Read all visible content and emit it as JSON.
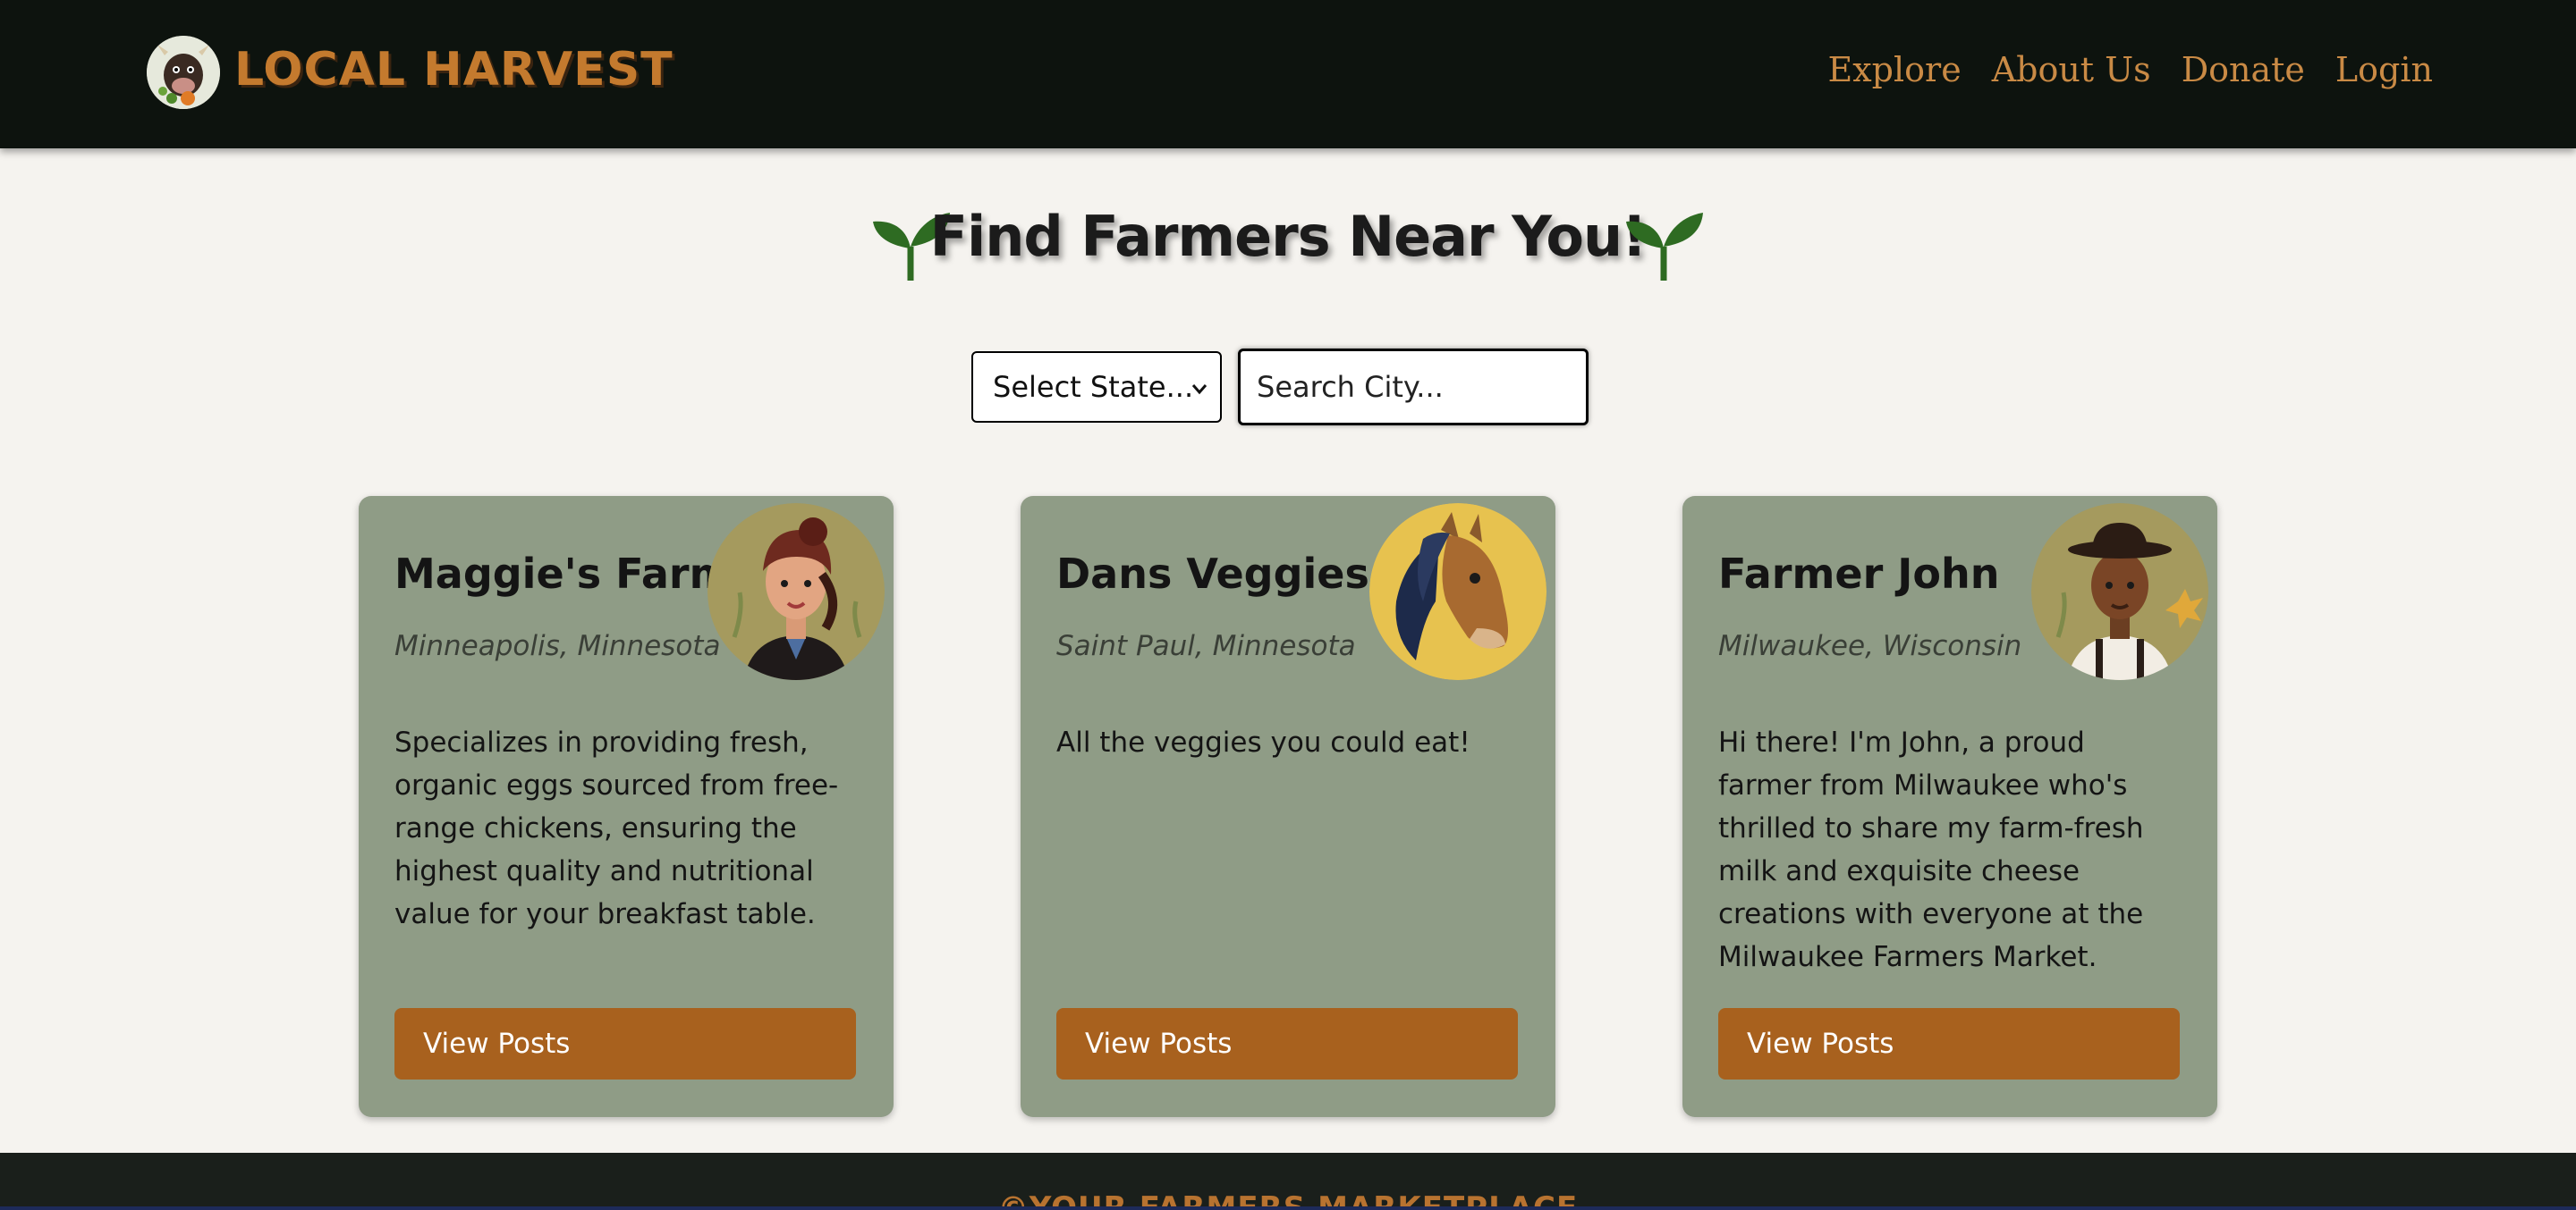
{
  "brand": {
    "name": "LOCAL HARVEST",
    "logo_icon": "cow-mascot-icon"
  },
  "nav": {
    "items": [
      "Explore",
      "About Us",
      "Donate",
      "Login"
    ]
  },
  "hero": {
    "title": "Find Farmers Near You!",
    "icon": "sprout-icon"
  },
  "filters": {
    "state_select": {
      "selected": "Select State..."
    },
    "city_search": {
      "placeholder": "Search City...",
      "value": ""
    }
  },
  "farmers": [
    {
      "name": "Maggie's Farm",
      "location": "Minneapolis, Minnesota",
      "description": "Specializes in providing fresh, organic eggs sourced from free-range chickens, ensuring the highest quality and nutritional value for your breakfast table.",
      "button": "View Posts",
      "avatar": "woman-farmer-avatar"
    },
    {
      "name": "Dans Veggies",
      "location": "Saint Paul, Minnesota",
      "description": "All the veggies you could eat!",
      "button": "View Posts",
      "avatar": "horse-avatar"
    },
    {
      "name": "Farmer John",
      "location": "Milwaukee, Wisconsin",
      "description": "Hi there! I'm John, a proud farmer from Milwaukee who's thrilled to share my farm-fresh milk and exquisite cheese creations with everyone at the Milwaukee Farmers Market.",
      "button": "View Posts",
      "avatar": "man-farmer-avatar"
    }
  ],
  "footer": {
    "text": "©YOUR FARMERS MARKETPLACE"
  },
  "colors": {
    "nav_bg": "#0d130e",
    "brand_orange": "#c47a2e",
    "nav_link": "#c98a45",
    "page_bg": "#f5f3ef",
    "card_bg": "#8f9c86",
    "button_bg": "#a8611e",
    "sprout_green": "#2e6b22"
  }
}
